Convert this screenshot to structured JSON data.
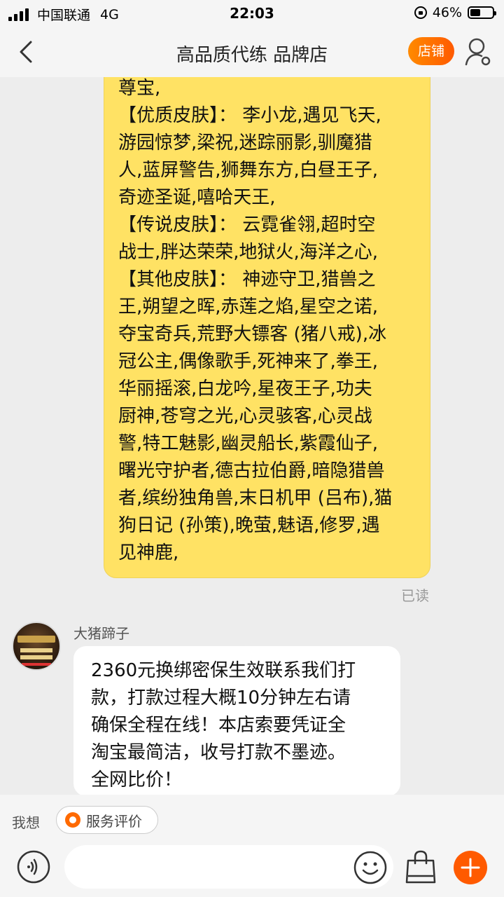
{
  "status_bar": {
    "carrier": "中国联通",
    "network": "4G",
    "time": "22:03",
    "battery_percent": "46%",
    "battery_level": 0.46
  },
  "header": {
    "title": "高品质代练 品牌店",
    "shop_button_label": "店铺"
  },
  "messages": {
    "outgoing": {
      "lines": [
        "尊宝,",
        "【优质皮肤】： 李小龙,遇见飞天,",
        "游园惊梦,梁祝,迷踪丽影,驯魔猎",
        "人,蓝屏警告,狮舞东方,白昼王子,",
        "奇迹圣诞,嘻哈天王,",
        "【传说皮肤】： 云霓雀翎,超时空",
        "战士,胖达荣荣,地狱火,海洋之心,",
        "【其他皮肤】： 神迹守卫,猎兽之",
        "王,朔望之晖,赤莲之焰,星空之诺,",
        "夺宝奇兵,荒野大镖客 (猪八戒),冰",
        "冠公主,偶像歌手,死神来了,拳王,",
        "华丽摇滚,白龙吟,星夜王子,功夫",
        "厨神,苍穹之光,心灵骇客,心灵战",
        "警,特工魅影,幽灵船长,紫霞仙子,",
        "曙光守护者,德古拉伯爵,暗隐猎兽",
        "者,缤纷独角兽,末日机甲 (吕布),猫",
        "狗日记 (孙策),晚萤,魅语,修罗,遇",
        "见神鹿,"
      ],
      "read_status": "已读"
    },
    "incoming": {
      "sender": "大猪蹄子",
      "lines": [
        "2360元换绑密保生效联系我们打",
        "款，打款过程大概10分钟左右请",
        "确保全程在线！本店索要凭证全",
        "淘宝最简洁，收号打款不墨迹。",
        "全网比价！"
      ]
    }
  },
  "quick_bar": {
    "label": "我想",
    "service_review": "服务评价"
  },
  "input": {
    "value": "",
    "placeholder": ""
  },
  "colors": {
    "accent": "#ff6a00",
    "outgoing_bubble": "#ffe264",
    "incoming_bubble": "#ffffff",
    "background": "#ededed"
  },
  "icons": [
    "back-icon",
    "user-settings-icon",
    "voice-icon",
    "emoji-icon",
    "shopping-bag-icon",
    "add-icon",
    "service-review-icon",
    "lock-rotation-icon",
    "battery-icon",
    "signal-icon"
  ]
}
